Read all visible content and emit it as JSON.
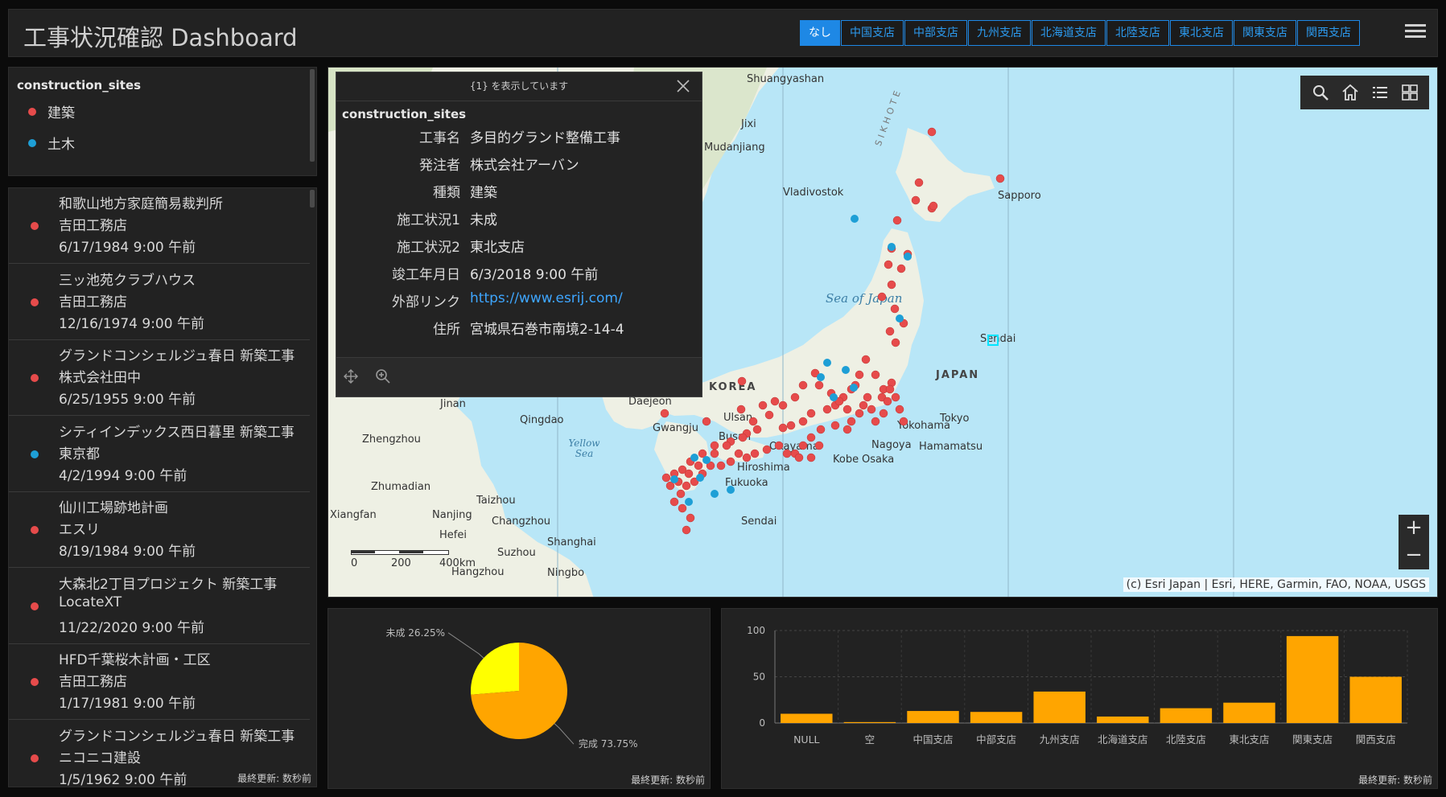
{
  "header": {
    "title": "工事状況確認 Dashboard",
    "branches": [
      {
        "label": "なし",
        "active": true
      },
      {
        "label": "中国支店",
        "active": false
      },
      {
        "label": "中部支店",
        "active": false
      },
      {
        "label": "九州支店",
        "active": false
      },
      {
        "label": "北海道支店",
        "active": false
      },
      {
        "label": "北陸支店",
        "active": false
      },
      {
        "label": "東北支店",
        "active": false
      },
      {
        "label": "関東支店",
        "active": false
      },
      {
        "label": "関西支店",
        "active": false
      }
    ],
    "menu_icon": "hamburger-menu-icon"
  },
  "legend": {
    "title": "construction_sites",
    "items": [
      {
        "label": "建築",
        "color": "#e64b4b"
      },
      {
        "label": "土木",
        "color": "#1e9fd6"
      }
    ]
  },
  "site_list": {
    "items": [
      {
        "name": "和歌山地方家庭簡易裁判所",
        "company": "吉田工務店",
        "date": "6/17/1984 9:00 午前",
        "color": "#e64b4b"
      },
      {
        "name": "三ッ池苑クラブハウス",
        "company": "吉田工務店",
        "date": "12/16/1974 9:00 午前",
        "color": "#e64b4b"
      },
      {
        "name": "グランドコンシェルジュ春日 新築工事",
        "company": "株式会社田中",
        "date": "6/25/1955 9:00 午前",
        "color": "#e64b4b"
      },
      {
        "name": "シティインデックス西日暮里 新築工事",
        "company": "東京都",
        "date": "4/2/1994 9:00 午前",
        "color": "#1e9fd6"
      },
      {
        "name": "仙川工場跡地計画",
        "company": "エスリ",
        "date": "8/19/1984 9:00 午前",
        "color": "#e64b4b"
      },
      {
        "name": "大森北2丁目プロジェクト 新築工事",
        "company": "LocateXT",
        "date": "11/22/2020 9:00 午前",
        "color": "#e64b4b"
      },
      {
        "name": "HFD千葉桜木計画・工区",
        "company": "吉田工務店",
        "date": "1/17/1981 9:00 午前",
        "color": "#e64b4b"
      },
      {
        "name": "グランドコンシェルジュ春日 新築工事",
        "company": "ニコニコ建設",
        "date": "1/5/1962 9:00 午前",
        "color": "#e64b4b"
      }
    ],
    "updated": "最終更新: 数秒前"
  },
  "map": {
    "labels": {
      "shuangyashan": "Shuangyashan",
      "jixi": "Jixi",
      "mudanjiang": "Mudanjiang",
      "vladivostok": "Vladivostok",
      "sapporo": "Sapporo",
      "sea_of_japan": "Sea of Japan",
      "sendai_n": "Sendai",
      "japan": "JAPAN",
      "korea": "KOREA",
      "jinan": "Jinan",
      "daejeon": "Daejeon",
      "ulsan": "Ulsan",
      "qingdao": "Qingdao",
      "gwangju": "Gwangju",
      "busan": "Busan",
      "zhengzhou": "Zhengzhou",
      "yellow_sea": "Yellow Sea",
      "okayama": "Okayama",
      "nagoya": "Nagoya",
      "yokohama": "Yokohama",
      "tokyo": "Tokyo",
      "hamamatsu": "Hamamatsu",
      "kobe": "Kobe",
      "osaka": "Osaka",
      "hiroshima": "Hiroshima",
      "fukuoka": "Fukuoka",
      "zhumadian": "Zhumadian",
      "taizhou": "Taizhou",
      "xiangfan": "Xiangfan",
      "nanjing": "Nanjing",
      "changzhou": "Changzhou",
      "hefei": "Hefei",
      "shanghai": "Shanghai",
      "suzhou": "Suzhou",
      "sendai_s": "Sendai",
      "hangzhou": "Hangzhou",
      "ningbo": "Ningbo",
      "sikhote": "SIKHOTE"
    },
    "scale": {
      "l0": "0",
      "l1": "200",
      "l2": "400km"
    },
    "attribution": "(c) Esri Japan | Esri, HERE, Garmin, FAO, NOAA, USGS",
    "tools": [
      "search-icon",
      "home-icon",
      "layer-list-icon",
      "basemap-gallery-icon"
    ],
    "zoom_in": "+",
    "zoom_out": "−"
  },
  "popup": {
    "header": "{1} を表示しています",
    "layer": "construction_sites",
    "attributes": [
      {
        "key": "工事名",
        "value": "多目的グランド整備工事"
      },
      {
        "key": "発注者",
        "value": "株式会社アーバン"
      },
      {
        "key": "種類",
        "value": "建築"
      },
      {
        "key": "施工状況1",
        "value": "未成"
      },
      {
        "key": "施工状況2",
        "value": "東北支店"
      },
      {
        "key": "竣工年月日",
        "value": "6/3/2018 9:00 午前"
      },
      {
        "key": "外部リンク",
        "value": "https://www.esrij.com/"
      },
      {
        "key": "住所",
        "value": "宮城県石巻市南境2-14-4"
      }
    ]
  },
  "pie_panel": {
    "updated": "最終更新: 数秒前"
  },
  "bar_panel": {
    "updated": "最終更新: 数秒前"
  },
  "chart_data": [
    {
      "type": "pie",
      "slices": [
        {
          "label": "未成",
          "value": 26.25,
          "display": "未成 26.25%",
          "color": "#ffff00"
        },
        {
          "label": "完成",
          "value": 73.75,
          "display": "完成 73.75%",
          "color": "#ffa500"
        }
      ]
    },
    {
      "type": "bar",
      "categories": [
        "NULL",
        "空",
        "中国支店",
        "中部支店",
        "九州支店",
        "北海道支店",
        "北陸支店",
        "東北支店",
        "関東支店",
        "関西支店"
      ],
      "values": [
        10,
        1,
        13,
        12,
        34,
        7,
        16,
        22,
        94,
        50
      ],
      "ylim": [
        0,
        100
      ],
      "yticks": [
        0,
        50,
        100
      ],
      "color": "#ffa500",
      "grid": true
    }
  ]
}
